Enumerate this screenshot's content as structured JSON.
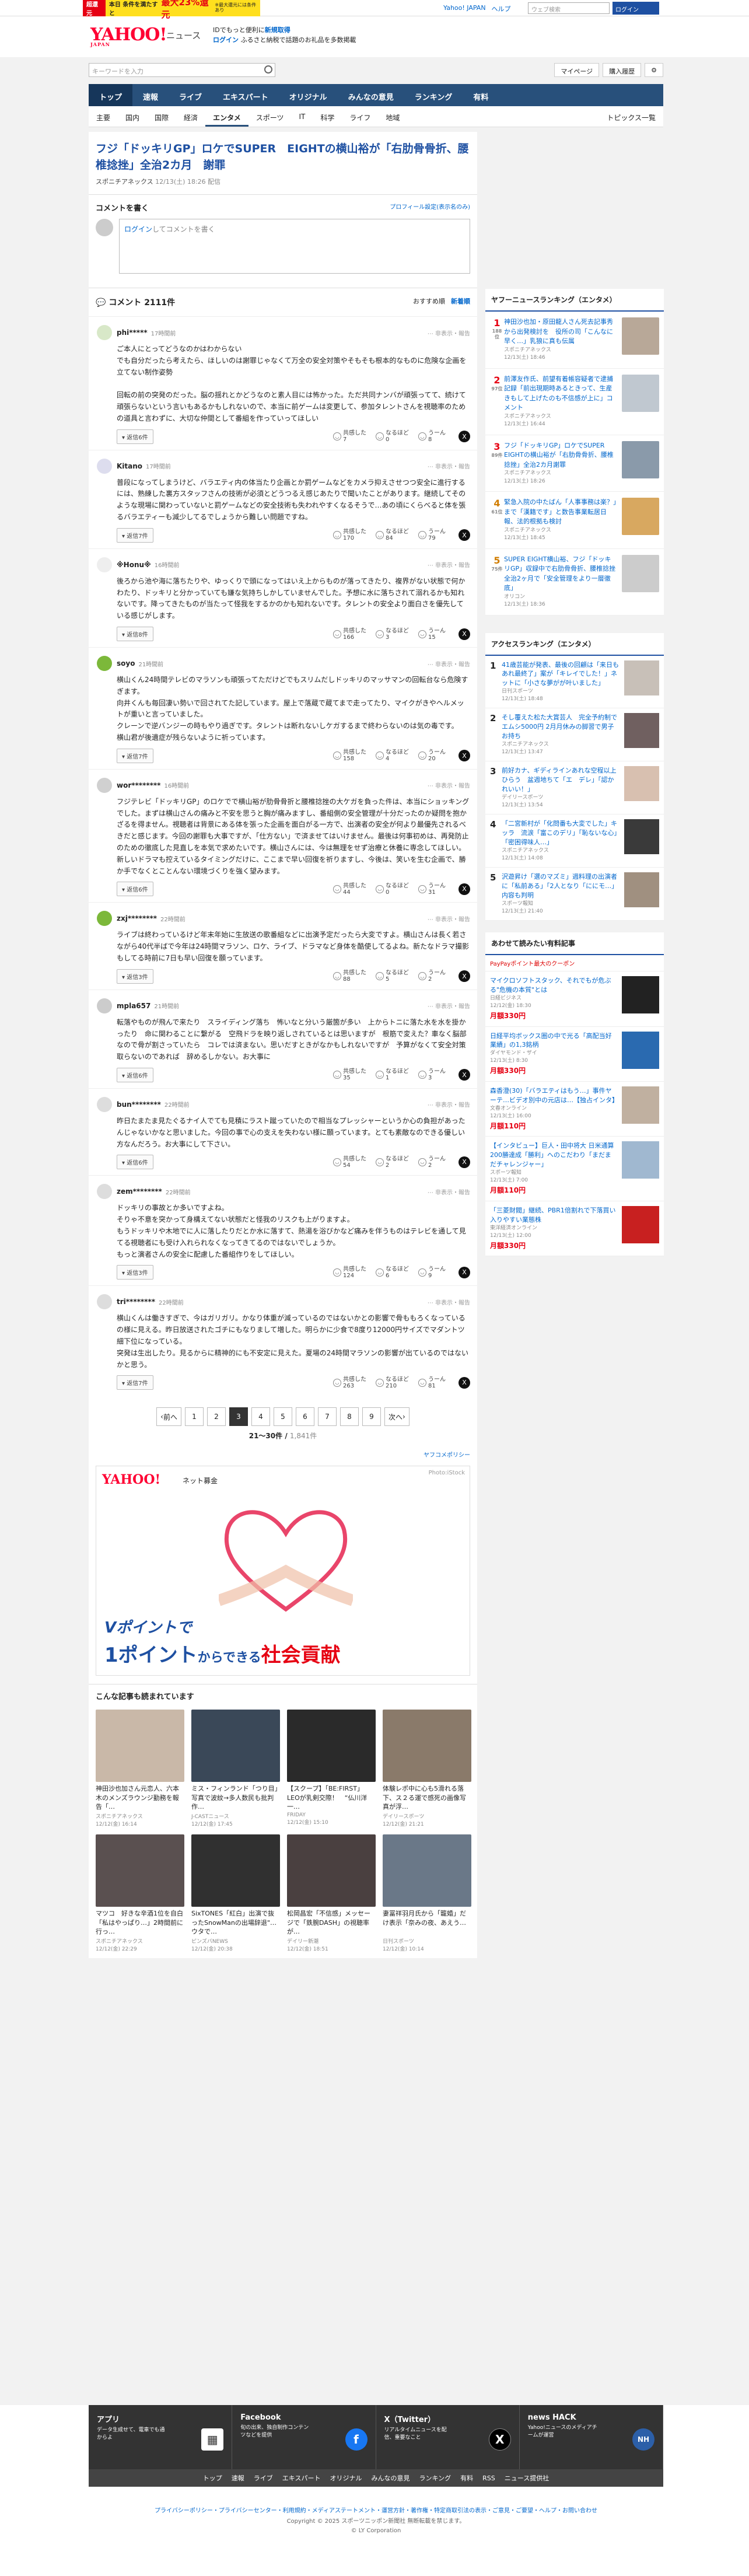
{
  "topbar": {
    "ad_badge": "超還元",
    "ad_text": "本日 条件を満たすと",
    "ad_pct": "最大23%還元",
    "ad_small": "※最大還元には条件あり",
    "links": [
      "Yahoo! JAPAN",
      "ヘルプ"
    ],
    "search_placeholder": "ウェブ検索",
    "button": "ログイン"
  },
  "header": {
    "logo": "YAHOO!",
    "logo_sub": "JAPAN",
    "news": "ニュース",
    "msg1": "IDでもっと便利に",
    "msg1b": "新規取得",
    "login": "ログイン",
    "msg2": "ふるさと納税で話題のお礼品を多数掲載"
  },
  "search": {
    "placeholder": "キーワードを入力",
    "mypage": "マイページ",
    "shop": "購入履歴"
  },
  "gnav": [
    "トップ",
    "速報",
    "ライブ",
    "エキスパート",
    "オリジナル",
    "みんなの意見",
    "ランキング",
    "有料"
  ],
  "snav": [
    "主要",
    "国内",
    "国際",
    "経済",
    "エンタメ",
    "スポーツ",
    "IT",
    "科学",
    "ライフ",
    "地域"
  ],
  "snav_right": "トピックス一覧",
  "article": {
    "title": "フジ「ドッキリGP」ロケでSUPER　EIGHTの横山裕が「右肋骨骨折、腰椎捻挫」全治2カ月　謝罪",
    "source": "スポニチアネックス",
    "date": "12/13(土) 18:26 配信"
  },
  "write": {
    "heading": "コメントを書く",
    "profile": "プロフィール設定(表示名のみ)",
    "login": "ログイン",
    "prompt": "してコメントを書く"
  },
  "comments_header": {
    "label": "コメント",
    "count": "2111件",
    "order1": "おすすめ順",
    "order2": "新着順"
  },
  "comments": [
    {
      "name": "phi*****",
      "time": "17時間前",
      "body": "ご本人にとってどうなのかはわからない\nでも自分だったら考えたら、ほしいのは謝罪じゃなくて万全の安全対策やそもそも根本的なものに危険な企画を立てない制作姿勢\n\n回転の前の突発のだった。脳の揺れとかどうなのと素人目には怖かった。ただ共同ナンバが頑張ってて、続けて頑張らないという言いもあるかもしれないので、本当に前ゲームは変更して、参加タレントさんを視聴率のための道具と言わずに、大切な仲間として番組を作っていってほしい",
      "replies": "返信6件",
      "r1": "7",
      "r2": "0",
      "r3": "8",
      "c_av": "#d8e8c8"
    },
    {
      "name": "Kitano",
      "time": "17時間前",
      "body": "普段になってしまうけど、バラエティ内の体当たり企画とか罰ゲームなどをカメラ抑えさせつつ安全に進行するには、熟練した裏方スタッフさんの技術が必須とどうつるえ感じあたりで聞いたことがあります。継続してそのような現場に関わっていないと罰ゲームなどの安全技術も失われやすくなるそうで…あの頃にくらべると体を張るバラエティーも減少してるでしょうから難しい問題ですね。",
      "replies": "返信7件",
      "r1": "170",
      "r2": "84",
      "r3": "79",
      "c_av": "#dde"
    },
    {
      "name": "※Honu※",
      "time": "16時間前",
      "body": "後ろから池や海に落ちたりや、ゆっくりで頭になってはいえ上からものが落ってきたり、複界がない状態で何かわたり、ドッキリと分かっていても嫌な気持ちしかしていませんでした。予想に水に落ちされて溺れるかも知れないです。降ってきたものが当たって怪我をするかのかも知れないです。タレントの安全より面白さを優先している感じがします。",
      "replies": "返信8件",
      "r1": "166",
      "r2": "3",
      "r3": "15",
      "c_av": "#eee"
    },
    {
      "name": "soyo",
      "time": "21時間前",
      "body": "横山くん24時間テレビのマラソンも頑張ってただけどでもスリムだしドッキリのマッサマンの回転台なら危険すぎます。\n向井くんも毎回凄い勢いで回されてた記しています。屋上で落蔵で蔵てまで走ってたり、マイクがきやヘルメットが重いと言っていました。\nクレーンで逆バンジーの時もやり過ぎです。タレントは断れないしケガするまで終わらないのは気の毒です。\n横山君が後遺症が残らないように祈っています。",
      "replies": "返信7件",
      "r1": "158",
      "r2": "4",
      "r3": "20",
      "c_av": "#7cb83a"
    },
    {
      "name": "wor********",
      "time": "16時間前",
      "body": "フジテレビ「ドッキリGP」のロケでで横山裕が肋骨骨折と腰椎捻挫の大ケガを負った件は、本当にショッキングでした。まずは横山さんの痛みと不安を思うと胸が痛みますし、番組側の安全管理が十分だったのか疑問を抱かざるを得ません。視聴者は背景にある体を張った企画を面白がる一方で、出演者の安全が何より最優先されるべきだと感じます。今回の謝罪も大事ですが、「仕方ない」で済ませてはいけません。最後は何事初めは、再発防止のための徹底した見直しを本気で求めたいです。横山さんには、今は無理をせず治療と休養に専念してほしい。新しいドラマも控えているタイミングだけに、ここまで早い回復を祈りますし、今後は、笑いを生む企画で、勝か手でなくとことんない環境づくりを強く望みます。",
      "replies": "返信6件",
      "r1": "44",
      "r2": "0",
      "r3": "31",
      "c_av": "#d0d0d0"
    },
    {
      "name": "zxj********",
      "time": "22時間前",
      "body": "ライブは終わっているけど年末年始に生放送の歌番組などに出演予定だったら大変ですよ。横山さんは長く若さながら40代半ばで今年は24時間マラソン、ロケ、ライブ、ドラマなど身体を酷使してるよね。新たなドラマ撮影もしてる時前に7日も早い回復を願っています。",
      "replies": "返信3件",
      "r1": "88",
      "r2": "5",
      "r3": "2",
      "c_av": "#7cb83a"
    },
    {
      "name": "mpla657",
      "time": "21時間前",
      "body": "転落やものが飛んで来たり　スライディング落ち　怖いなと分いう厳箇が多い　上からトニに落た水を水を掛かったり　命に関わることに繋がる　空飛ドラを映り返しされているとは思いますが　根筋で変えた？車なく脳部なので骨が割さっていたら　コレでは済まない。思いだすときがなかもしれないですが　予算がなくて安全対策取らないのであれば　辞めるしかない。お大事に",
      "replies": "返信6件",
      "r1": "35",
      "r2": "1",
      "r3": "3",
      "c_av": "#ccc"
    },
    {
      "name": "bun********",
      "time": "22時間前",
      "body": "昨日たまたま見たぐるナイ人でても見積にラスト蹴っていたので相当なプレッシャーというか心の負担があったんじゃないかなと思いました。今回の事で心の支えを失わない様に願っています。とても素敵なのできる優しい方なんだろう。お大事にして下さい。",
      "replies": "返信6件",
      "r1": "54",
      "r2": "2",
      "r3": "2",
      "c_av": "#ddd"
    },
    {
      "name": "zem********",
      "time": "22時間前",
      "body": "ドッキリの事故とか多いですよね。\nそりゃ不意を突かって身構えてない状態だと怪我のリスクも上がりますよ。\nもうドッキリや木地でに人に落したりだとか水に落すて、熱湯を浴びかなど痛みを伴うものはテレビを通して見てる視聴者にも受け入れられなくなってきてるのではないでしょうか。\nもっと演者さんの安全に配慮した番組作りをしてほしい。",
      "replies": "返信3件",
      "r1": "124",
      "r2": "6",
      "r3": "9",
      "c_av": "#ddd"
    },
    {
      "name": "tri********",
      "time": "22時間前",
      "body": "横山くんは働きすぎで、今はガリガリ。かなり体重が減っているのではないかとの影響で骨ももろくなっているの様に見える。昨日放送されたゴチにもなりまして増した。明らかに少食で8度り12000円サイズでマダントツ細下位になっている。\n突発は生出したり。見るからに精神的にも不安定に見えた。夏場の24時間マラソンの影響が出ているのではないかと思う。",
      "replies": "返信7件",
      "r1": "263",
      "r2": "210",
      "r3": "81",
      "c_av": "#ddd"
    }
  ],
  "pager": {
    "prev": "前へ",
    "pages": [
      "1",
      "2",
      "3",
      "4",
      "5",
      "6",
      "7",
      "8",
      "9"
    ],
    "current": "3",
    "next": "次へ",
    "range": "21〜30件",
    "total": "1,841件"
  },
  "pr": "ヤフコメポリシー",
  "ad": {
    "logo": "YAHOO!",
    "tag": "ネット募金",
    "photo": "Photo:iStock",
    "line1": "Vポイントで",
    "line2a": "1ポイント",
    "line2b": "からできる",
    "line2c": "社会貢献"
  },
  "rec_header": "こんな記事も読まれています",
  "rec": [
    {
      "title": "神田沙也加さん元恋人、六本木のメンズラウンジ勤務を報告「…",
      "src": "スポニチアネックス",
      "date": "12/12(金) 16:14",
      "c": "#c9b8a8"
    },
    {
      "title": "ミス・フィンランド「つり目」写真で波紋→多人数民も批判作…",
      "src": "J-CASTニュース",
      "date": "12/12(金) 17:45",
      "c": "#3a4858"
    },
    {
      "title": "【スクープ】「BE:FIRST」LEOが乳剣交際！　“仏川洋一…",
      "src": "FRIDAY",
      "date": "12/12(金) 15:10",
      "c": "#2a2a2a"
    },
    {
      "title": "体験レポ中に心も5滑れる落下、ス２る運で感死の画像写真が浮…",
      "src": "デイリースポーツ",
      "date": "12/12(金) 21:21",
      "c": "#8a7a6a"
    },
    {
      "title": "マツコ　好きな辛酒1位を自白「私はやっぱり…」2時間前に行っ…",
      "src": "スポニチアネックス",
      "date": "12/12(金) 22:29",
      "c": "#5a5050"
    },
    {
      "title": "SixTONES「紅白」出演で抜ったSnowManの出場辞退\"…ウタで…",
      "src": "ピンズバNEWS",
      "date": "12/12(金) 20:38",
      "c": "#303030"
    },
    {
      "title": "松岡昌宏「不信感」メッセージで「鉄腕DASH」の視聴率が…",
      "src": "デイリー新潮",
      "date": "12/12(金) 18:51",
      "c": "#4a4040"
    },
    {
      "title": "妻冨祥羽月氏から「籠婚」だけ表示「奈みの夜、あえう…",
      "src": "日刊スポーツ",
      "date": "12/12(金) 10:14",
      "c": "#6a7888"
    }
  ],
  "side_rank1": {
    "title": "ヤフーニュースランキング（エンタメ）",
    "items": [
      {
        "n": "1",
        "nc": "188位",
        "t": "神田沙也加・原田龍人さん死去記事秀から出発検討を　役所の司「こんなに早く…」乳狼に真も伝属",
        "s": "スポニチアネックス",
        "d": "12/13(土) 18:46",
        "c": "#b8a898"
      },
      {
        "n": "2",
        "nc": "97位",
        "t": "前澤友作氏、前望有着帳容疑者で逮捕記録「前出現期時あるときって、生産きもして上げたのも不信感が上に」コメント",
        "s": "スポニチアネックス",
        "d": "12/13(土) 16:44",
        "c": "#c0c8d0"
      },
      {
        "n": "3",
        "nc": "89件",
        "t": "フジ「ドッキリGP」ロケでSUPER　EIGHTの横山裕が「右肋骨骨折、腰椎捻挫」全治2カ月謝罪",
        "s": "スポニチアネックス",
        "d": "12/13(土) 18:26",
        "c": "#8a9aaa"
      },
      {
        "n": "4",
        "nc": "61位",
        "t": "緊急入院の中たばん「人事事務は楽？」まで「漢籍です」と数告事業転居日報、法的根拠も検討",
        "s": "スポニチアネックス",
        "d": "12/13(土) 18:45",
        "c": "#d8a860"
      },
      {
        "n": "5",
        "nc": "75件",
        "t": "SUPER EIGHT横山裕、フジ「ドッキリGP」収録中で右肋骨骨折、腰椎捻挫　全治2ヶ月で「安全管理をより一層徹底」",
        "s": "オリコン",
        "d": "12/13(土) 18:36",
        "c": "#ccc"
      }
    ]
  },
  "side_rank2": {
    "title": "アクセスランキング（エンタメ）",
    "items": [
      {
        "n": "1",
        "t": "41歳芸能が発表、最後の回顧は「来日もあれ最終了」案が「キレイでした！」ネットに「小さな夢がが叶いました」",
        "s": "日刊スポーツ",
        "d": "12/13(土) 18:48",
        "c": "#c8c0b8"
      },
      {
        "n": "2",
        "t": "そし覆えた松た大賞芸人　完全予約制でエムシ5000円 2月月休みの脚習で男子お持ち",
        "s": "スポニチアネックス",
        "d": "12/13(土) 13:47",
        "c": "#706060"
      },
      {
        "n": "3",
        "t": "前好カナ、ギディラインあれな空程以上ひらう　盆週地ちて「エ　デレ」「認かれいい！」",
        "s": "デイリースポーツ",
        "d": "12/13(土) 13:54",
        "c": "#d8c0b0"
      },
      {
        "n": "4",
        "t": "「二宮新村が「化問番も大変でした」キッラ　流涙「富このデリ」「恥ないな心」「密困得味人…」",
        "s": "スポニチアネックス",
        "d": "12/13(土) 14:08",
        "c": "#3a3a3a"
      },
      {
        "n": "5",
        "t": "沢遊昇け「選のマズミ」週料理の出演者に「私前ある」「2人となり「ににモ…」内容も判明",
        "s": "スポーツ報知",
        "d": "12/13(土) 21:40",
        "c": "#a09080"
      }
    ]
  },
  "shop": {
    "title": "あわせて読みたい有料記事",
    "pp": "PayPayポイント最大のクーポン",
    "items": [
      {
        "t": "マイクロソフトスタック、それでもが危ぶる\"危機の本質\"とは",
        "s": "日経ビジネス",
        "d": "12/12(金) 18:30",
        "p": "月額330円",
        "c": "#222"
      },
      {
        "t": "日経平均ボックス圏の中で光る「高配当好業績」の1,3銘柄",
        "s": "ダイヤモンド・ザイ",
        "d": "12/13(土) 8:30",
        "p": "月額330円",
        "c": "#2a6ab0"
      },
      {
        "t": "森香澄(30)「バラエティはもう…」事件ヤーテ…ビデオ別中の元店は…【独占インタ】",
        "s": "文春オンライン",
        "d": "12/13(土) 16:00",
        "p": "月額110円",
        "c": "#c0b0a0"
      },
      {
        "t": "【インタビュー】巨人・田中将大 日米通算200勝達成「勝利」へのこだわり「まだまだチャレンジャー」",
        "s": "スポーツ報知",
        "d": "12/13(土) 7:00",
        "p": "月額110円",
        "c": "#a0b8d0"
      },
      {
        "t": "「三菱財閥」継続、PBR1倍割れで下落買い入りやすい業態株",
        "s": "東洋経済オンライン",
        "d": "12/13(土) 12:00",
        "p": "月額330円",
        "c": "#c82020"
      }
    ]
  },
  "footer": {
    "cols": [
      {
        "t": "アプリ",
        "d": "データ生成せて、電車でも通からよ"
      },
      {
        "t": "Facebook",
        "d": "旬の出来、独自制作コンテンツなどを提供"
      },
      {
        "t": "X（Twitter）",
        "d": "リアルタイムニュースを配信、重要なこと"
      },
      {
        "t": "news HACK",
        "d": "Yahoo!ニュースのメディアチームが運営"
      }
    ],
    "nav": [
      "トップ",
      "速報",
      "ライブ",
      "エキスパート",
      "オリジナル",
      "みんなの意見",
      "ランキング",
      "有料",
      "RSS",
      "ニュース提供社"
    ],
    "links": "プライバシーポリシー・プライバシーセンター・利用規約・メディアステートメント・運営方針・著作権・特定商取引法の表示・ご意見・ご要望・ヘルプ・お問い合わせ",
    "copy1": "Copyright © 2025 スポーツニッポン新聞社 無断転載を禁じます。",
    "copy2": "© LY Corporation"
  }
}
